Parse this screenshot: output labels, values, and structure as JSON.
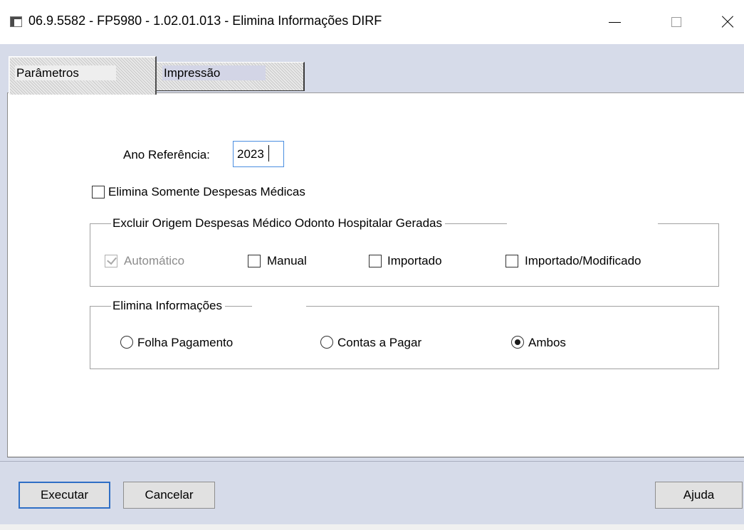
{
  "window": {
    "title": "06.9.5582 - FP5980 - 1.02.01.013 - Elimina Informações DIRF"
  },
  "tabs": [
    {
      "label": "Parâmetros",
      "active": true
    },
    {
      "label": "Impressão",
      "active": false
    }
  ],
  "form": {
    "ano_label": "Ano Referência:",
    "ano_value": "2023",
    "somente_medicas": {
      "label": "Elimina Somente Despesas Médicas",
      "checked": false
    },
    "origem_group": {
      "title": "Excluir Origem Despesas Médico Odonto Hospitalar Geradas",
      "options": [
        {
          "label": "Automático",
          "checked": true,
          "disabled": true
        },
        {
          "label": "Manual",
          "checked": false
        },
        {
          "label": "Importado",
          "checked": false
        },
        {
          "label": "Importado/Modificado",
          "checked": false
        }
      ]
    },
    "elimina_group": {
      "title": "Elimina Informações",
      "options": [
        {
          "label": "Folha Pagamento",
          "selected": false
        },
        {
          "label": "Contas a Pagar",
          "selected": false
        },
        {
          "label": "Ambos",
          "selected": true
        }
      ]
    }
  },
  "buttons": {
    "executar": "Executar",
    "cancelar": "Cancelar",
    "ajuda": "Ajuda"
  },
  "icons": {
    "app": "app-window-icon",
    "minimize": "minimize-icon",
    "maximize": "maximize-icon",
    "close": "close-icon"
  },
  "colors": {
    "window_bg": "#d6dbe9",
    "focus_border": "#4a8ee0",
    "default_button_border": "#2f6fc5"
  }
}
